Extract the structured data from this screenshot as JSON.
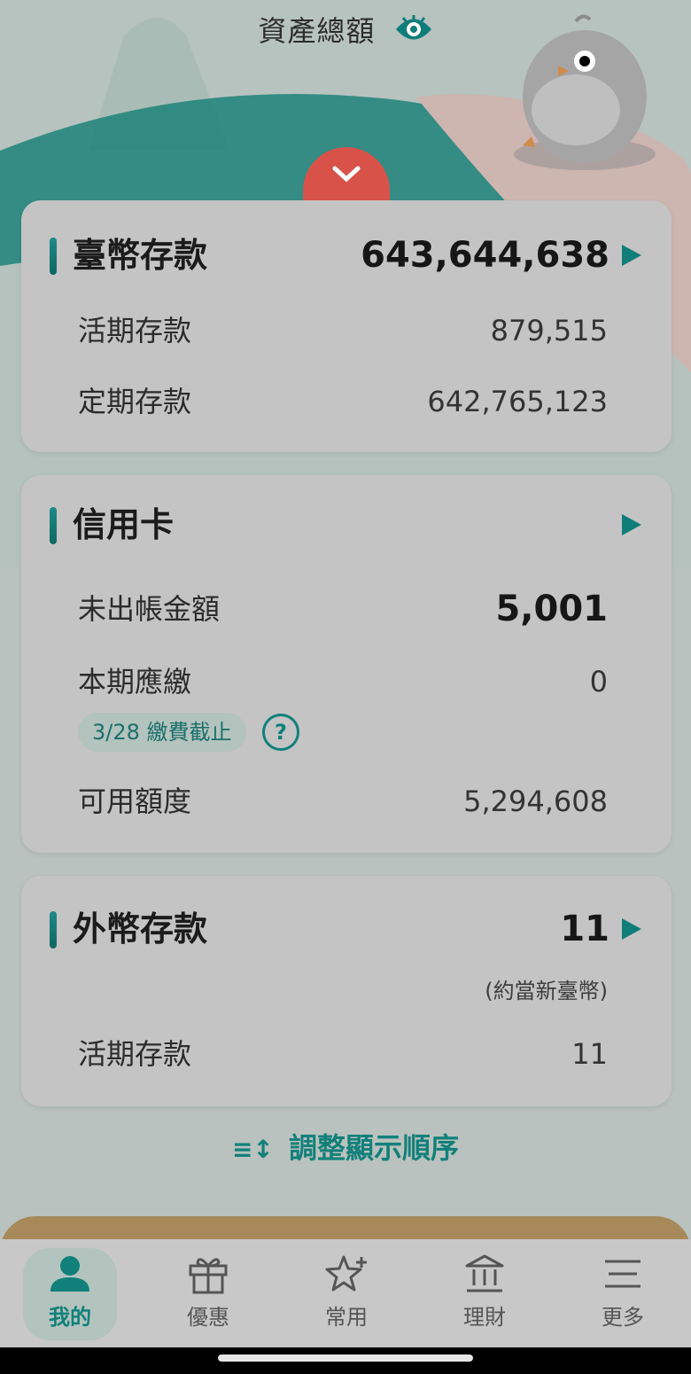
{
  "header": {
    "title": "資產總額",
    "eye_icon": "eye-icon",
    "collapse_icon": "chevron-down-icon"
  },
  "deposits_twd": {
    "title": "臺幣存款",
    "total": "643,644,638",
    "rows": [
      {
        "label": "活期存款",
        "value": "879,515"
      },
      {
        "label": "定期存款",
        "value": "642,765,123"
      }
    ]
  },
  "credit_card": {
    "title": "信用卡",
    "unbilled_label": "未出帳金額",
    "unbilled_value": "5,001",
    "due_label": "本期應繳",
    "due_value": "0",
    "deadline_pill": "3/28 繳費截止",
    "help_icon": "?",
    "available_label": "可用額度",
    "available_value": "5,294,608"
  },
  "deposits_foreign": {
    "title": "外幣存款",
    "total": "11",
    "note": "(約當新臺幣)",
    "rows": [
      {
        "label": "活期存款",
        "value": "11"
      }
    ]
  },
  "reorder": {
    "icon": "≡↕",
    "label": "調整顯示順序"
  },
  "tabs": [
    {
      "label": "我的",
      "icon": "person-icon",
      "active": true
    },
    {
      "label": "優惠",
      "icon": "gift-icon",
      "active": false
    },
    {
      "label": "常用",
      "icon": "star-plus-icon",
      "active": false
    },
    {
      "label": "理財",
      "icon": "bank-icon",
      "active": false
    },
    {
      "label": "更多",
      "icon": "menu-icon",
      "active": false
    }
  ],
  "colors": {
    "accent": "#11807b",
    "collapse": "#d9524a",
    "card": "#c4c4c4",
    "background": "#b9c2be"
  }
}
